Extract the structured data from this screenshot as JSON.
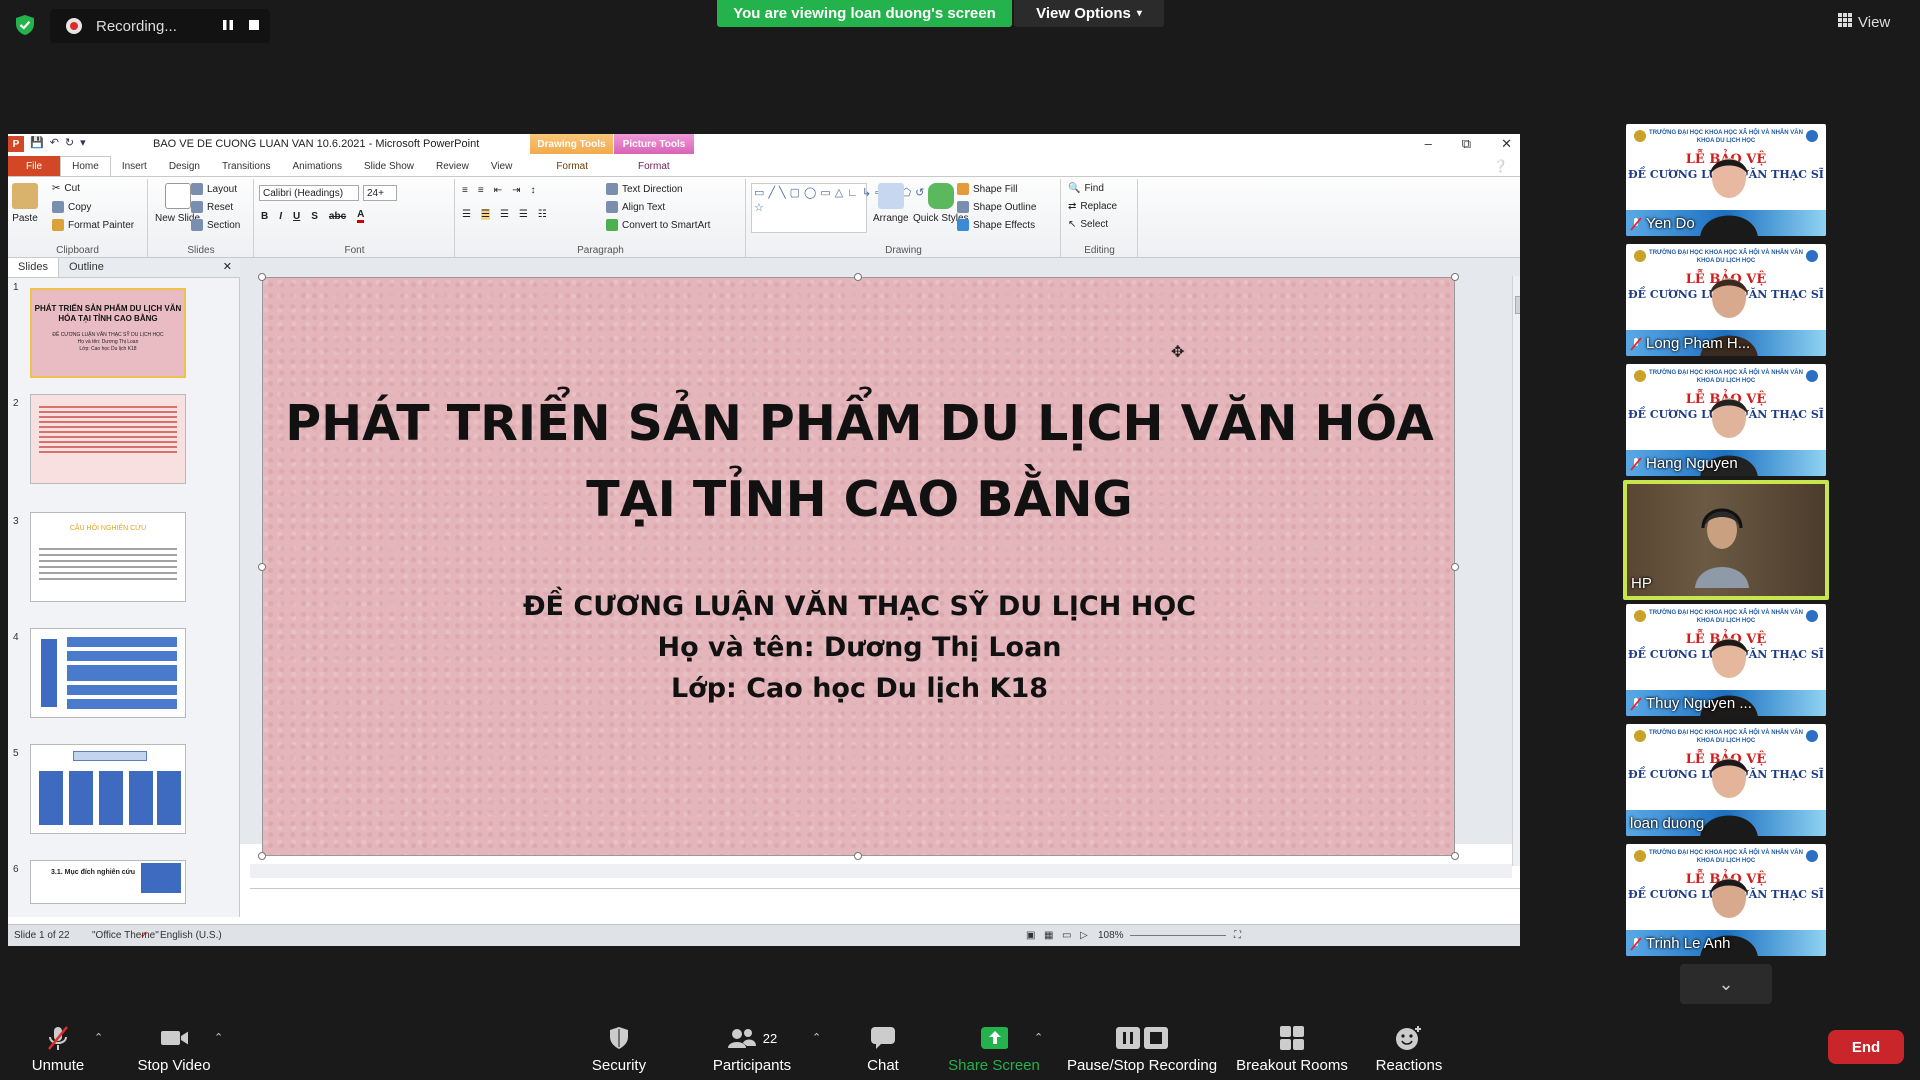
{
  "zoom": {
    "recording_label": "Recording...",
    "viewing_banner": "You are viewing loan duong's screen",
    "view_options": "View Options",
    "view_label": "View",
    "participants_count": "22",
    "toolbar": {
      "unmute": "Unmute",
      "stop_video": "Stop Video",
      "security": "Security",
      "participants": "Participants",
      "chat": "Chat",
      "share_screen": "Share Screen",
      "pause_stop_recording": "Pause/Stop Recording",
      "breakout_rooms": "Breakout Rooms",
      "reactions": "Reactions",
      "end": "End"
    },
    "share_color": "#23b24b",
    "end_color": "#c8262b",
    "participants_list": [
      {
        "name": "Yen Do"
      },
      {
        "name": "Long Pham H..."
      },
      {
        "name": "Hang Nguyen"
      },
      {
        "name": "HP"
      },
      {
        "name": "Thuy Nguyen ..."
      },
      {
        "name": "loan duong"
      },
      {
        "name": "Trinh Le Anh"
      }
    ],
    "tile_banner": {
      "line1": "TRƯỜNG ĐẠI HỌC KHOA HỌC XÃ HỘI VÀ NHÂN VĂN",
      "line2": "KHOA DU LỊCH HỌC",
      "le_bao_ve": "LỄ BẢO VỆ",
      "de_cuong": "ĐỀ CƯƠNG LUẬN VĂN THẠC SĨ"
    }
  },
  "ppt": {
    "window_title": "BAO VE DE CUONG LUAN VAN 10.6.2021 - Microsoft PowerPoint",
    "ctx_drawing_tools": "Drawing Tools",
    "ctx_picture_tools": "Picture Tools",
    "tabs": [
      "File",
      "Home",
      "Insert",
      "Design",
      "Transitions",
      "Animations",
      "Slide Show",
      "Review",
      "View",
      "Format",
      "Format"
    ],
    "ribbon": {
      "clipboard": {
        "paste": "Paste",
        "cut": "Cut",
        "copy": "Copy",
        "format_painter": "Format Painter",
        "label": "Clipboard"
      },
      "slides": {
        "new_slide": "New Slide",
        "layout": "Layout",
        "reset": "Reset",
        "section": "Section",
        "label": "Slides"
      },
      "font": {
        "name": "Calibri (Headings)",
        "size": "24+",
        "label": "Font"
      },
      "paragraph": {
        "text_direction": "Text Direction",
        "align_text": "Align Text",
        "convert_smartart": "Convert to SmartArt",
        "label": "Paragraph"
      },
      "drawing": {
        "arrange": "Arrange",
        "quick_styles": "Quick Styles",
        "shape_fill": "Shape Fill",
        "shape_outline": "Shape Outline",
        "shape_effects": "Shape Effects",
        "label": "Drawing"
      },
      "editing": {
        "find": "Find",
        "replace": "Replace",
        "select": "Select",
        "label": "Editing"
      }
    },
    "panel_tabs": {
      "slides": "Slides",
      "outline": "Outline"
    },
    "thumbnails": {
      "n1": "1",
      "n2": "2",
      "n3": "3",
      "n4": "4",
      "n5": "5",
      "n6": "6",
      "t1_title": "PHÁT TRIỂN SẢN PHẨM DU LỊCH VĂN HÓA TẠI TỈNH CAO BẰNG",
      "t1_sub": "ĐỀ CƯƠNG LUẬN VĂN THẠC SỸ DU LỊCH HỌC\nHọ và tên: Dương Thị Loan\nLớp: Cao học Du lịch K18",
      "t3_title": "CÂU HỎI NGHIÊN CỨU",
      "t6_title": "3.1. Mục đích nghiên cứu"
    },
    "slide": {
      "title_line1": "PHÁT TRIỂN SẢN PHẨM DU LỊCH VĂN HÓA",
      "title_line2": "TẠI TỈNH CAO BẰNG",
      "sub_line1": "ĐỀ CƯƠNG LUẬN VĂN THẠC SỸ DU LỊCH HỌC",
      "sub_line2": "Họ và tên: Dương Thị Loan",
      "sub_line3": "Lớp: Cao học Du lịch K18"
    },
    "status": {
      "slide_of": "Slide 1 of 22",
      "theme": "\"Office Theme\"",
      "language": "English (U.S.)",
      "zoom": "108%"
    }
  }
}
